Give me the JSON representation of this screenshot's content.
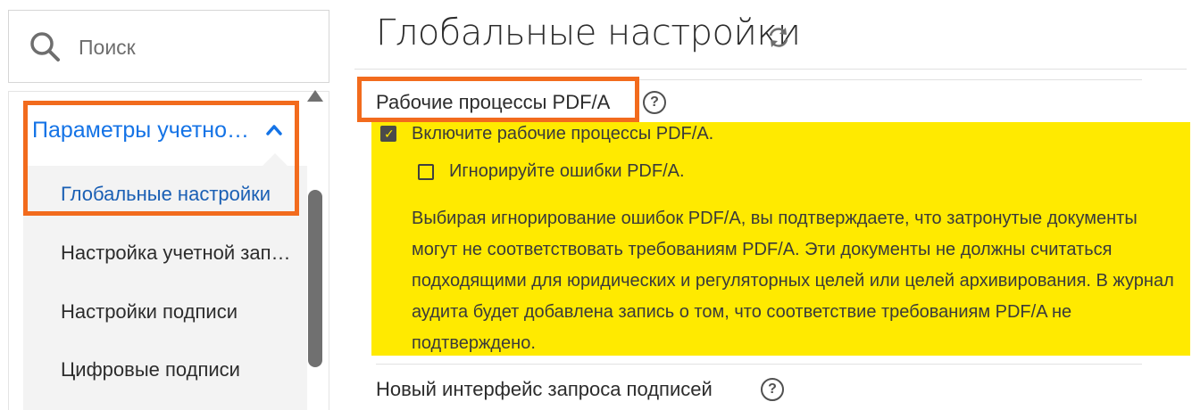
{
  "search": {
    "placeholder": "Поиск"
  },
  "sidebar": {
    "group_label": "Параметры учетно…",
    "items": [
      {
        "label": "Глобальные настройки",
        "active": true
      },
      {
        "label": "Настройка учетной зап…",
        "active": false
      },
      {
        "label": "Настройки подписи",
        "active": false
      },
      {
        "label": "Цифровые подписи",
        "active": false
      }
    ]
  },
  "main": {
    "title": "Глобальные настройки",
    "sections": [
      {
        "title": "Рабочие процессы PDF/A",
        "help": "?",
        "checkboxes": [
          {
            "label": "Включите рабочие процессы PDF/A.",
            "checked": true
          },
          {
            "label": "Игнорируйте ошибки PDF/A.",
            "checked": false
          }
        ],
        "description": "Выбирая игнорирование ошибок PDF/A, вы подтверждаете, что затронутые документы могут не соответствовать требованиям PDF/A. Эти документы не должны считаться подходящими для юридических и регуляторных целей или целей архивирования. В журнал аудита будет добавлена запись о том, что соответствие требованиям PDF/A не подтверждено."
      },
      {
        "title": "Новый интерфейс запроса подписей",
        "help": "?"
      }
    ]
  },
  "colors": {
    "accent": "#1473e6",
    "highlight": "#ffea00",
    "annotation": "#f26b1d",
    "scrollbar": "#707070"
  },
  "icons": [
    "search-icon",
    "chevron-up-icon",
    "refresh-icon",
    "help-icon",
    "checkmark-icon"
  ]
}
